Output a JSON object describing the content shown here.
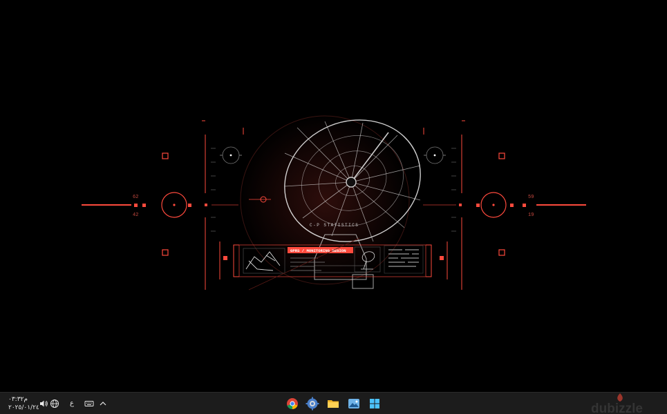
{
  "hud": {
    "left_top_number": "62",
    "left_bottom_number": "42",
    "right_top_number": "59",
    "right_bottom_number": "19",
    "dish_label": "C-P STATISTICS",
    "panel_title": "GPRS / MONITORING REGION",
    "accent_color": "#ff4a3d"
  },
  "taskbar": {
    "time": "م٠٣:٣٢",
    "date": "٢٠٢٥/٠١/٢٤",
    "language": "ع",
    "apps": [
      "chrome-icon",
      "settings-icon",
      "file-explorer-icon",
      "photos-icon",
      "start-icon"
    ]
  },
  "watermark": {
    "brand": "dubizzle"
  }
}
